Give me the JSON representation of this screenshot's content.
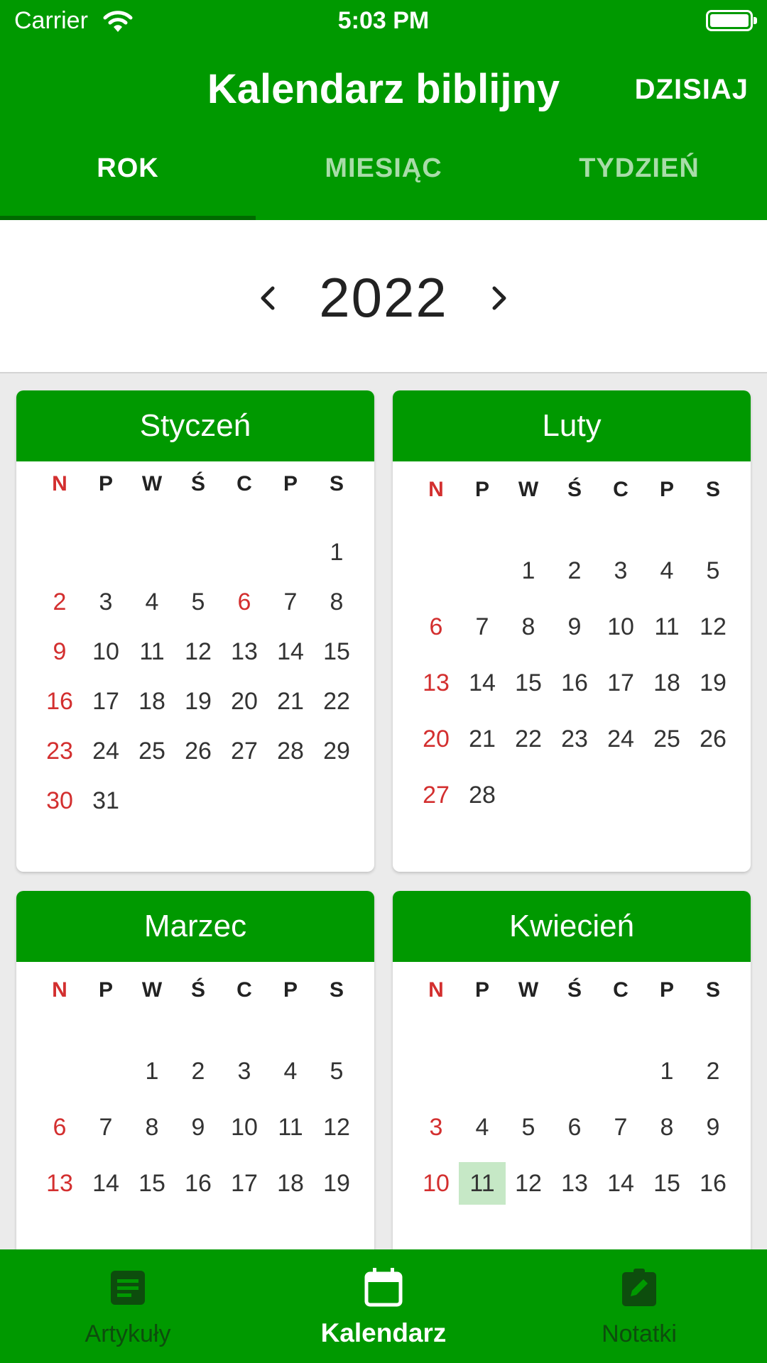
{
  "status_bar": {
    "carrier": "Carrier",
    "time": "5:03 PM"
  },
  "header": {
    "title": "Kalendarz biblijny",
    "today_button": "DZISIAJ"
  },
  "tabs": [
    {
      "label": "ROK",
      "active": true
    },
    {
      "label": "MIESIĄC",
      "active": false
    },
    {
      "label": "TYDZIEŃ",
      "active": false
    }
  ],
  "year_nav": {
    "year": "2022",
    "prev_icon": "chevron-left-icon",
    "next_icon": "chevron-right-icon"
  },
  "weekdays": [
    "N",
    "P",
    "W",
    "Ś",
    "C",
    "P",
    "S"
  ],
  "months": [
    {
      "name": "Styczeń",
      "first_weekday": 6,
      "days": 31
    },
    {
      "name": "Luty",
      "first_weekday": 2,
      "days": 28
    },
    {
      "name": "Marzec",
      "first_weekday": 2,
      "days": 19
    },
    {
      "name": "Kwiecień",
      "first_weekday": 5,
      "days": 16,
      "selected_day": 11
    }
  ],
  "holiday_days": {
    "Styczeń": [
      6
    ]
  },
  "bottom_nav": [
    {
      "label": "Artykuły",
      "icon": "article-icon",
      "active": false
    },
    {
      "label": "Kalendarz",
      "icon": "calendar-icon",
      "active": true
    },
    {
      "label": "Notatki",
      "icon": "note-edit-icon",
      "active": false
    }
  ],
  "colors": {
    "brand": "#009900",
    "sunday": "#d32f2f",
    "selected_day_bg": "#c6e8c6"
  }
}
